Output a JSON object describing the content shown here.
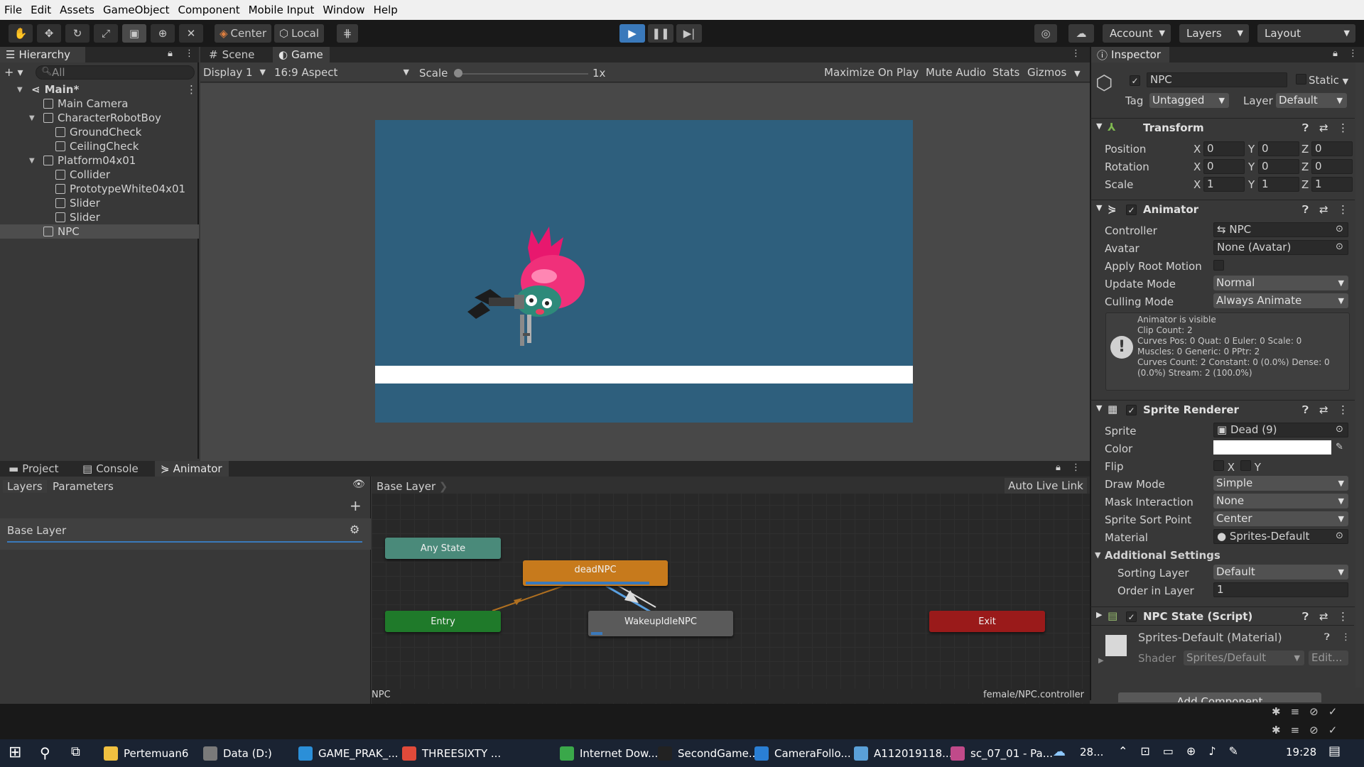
{
  "menu": [
    "File",
    "Edit",
    "Assets",
    "GameObject",
    "Component",
    "Mobile Input",
    "Window",
    "Help"
  ],
  "toolbar": {
    "pivot_label": "Center",
    "space_label": "Local",
    "account_label": "Account",
    "layers_label": "Layers",
    "layout_label": "Layout"
  },
  "hierarchy": {
    "tab_label": "Hierarchy",
    "search_placeholder": "All",
    "items": [
      {
        "label": "Main*",
        "depth": 0,
        "scene": true
      },
      {
        "label": "Main Camera",
        "depth": 1
      },
      {
        "label": "CharacterRobotBoy",
        "depth": 1,
        "expanded": true
      },
      {
        "label": "GroundCheck",
        "depth": 2
      },
      {
        "label": "CeilingCheck",
        "depth": 2
      },
      {
        "label": "Platform04x01",
        "depth": 1,
        "expanded": true
      },
      {
        "label": "Collider",
        "depth": 2
      },
      {
        "label": "PrototypeWhite04x01",
        "depth": 2
      },
      {
        "label": "Slider",
        "depth": 2
      },
      {
        "label": "Slider",
        "depth": 2
      },
      {
        "label": "NPC",
        "depth": 1,
        "selected": true
      }
    ]
  },
  "game_view": {
    "tabs": [
      "Scene",
      "Game"
    ],
    "display": "Display 1",
    "aspect": "16:9 Aspect",
    "scale_label": "Scale",
    "scale_value": "1x",
    "maximize": "Maximize On Play",
    "mute": "Mute Audio",
    "stats": "Stats",
    "gizmos": "Gizmos",
    "sky_color": "#2e5f7d"
  },
  "bottom": {
    "tabs": [
      "Project",
      "Console",
      "Animator"
    ],
    "layers_tab": "Layers",
    "params_tab": "Parameters",
    "base_layer": "Base Layer",
    "breadcrumb": "Base Layer",
    "auto_live_link": "Auto Live Link",
    "footer_left": "NPC",
    "footer_right": "female/NPC.controller",
    "nodes": {
      "any_state": "Any State",
      "dead": "deadNPC",
      "entry": "Entry",
      "wakeup": "WakeupIdleNPC",
      "exit": "Exit"
    }
  },
  "inspector": {
    "tab_label": "Inspector",
    "object_name": "NPC",
    "static_label": "Static",
    "tag_label": "Tag",
    "tag_value": "Untagged",
    "layer_label": "Layer",
    "layer_value": "Default",
    "transform": {
      "title": "Transform",
      "rows": [
        {
          "label": "Position",
          "x": "0",
          "y": "0",
          "z": "0"
        },
        {
          "label": "Rotation",
          "x": "0",
          "y": "0",
          "z": "0"
        },
        {
          "label": "Scale",
          "x": "1",
          "y": "1",
          "z": "1"
        }
      ]
    },
    "animator": {
      "title": "Animator",
      "controller_label": "Controller",
      "controller_value": "NPC",
      "avatar_label": "Avatar",
      "avatar_value": "None (Avatar)",
      "root_motion_label": "Apply Root Motion",
      "update_label": "Update Mode",
      "update_value": "Normal",
      "culling_label": "Culling Mode",
      "culling_value": "Always Animate",
      "info": [
        "Animator is visible",
        "Clip Count: 2",
        "Curves Pos: 0 Quat: 0 Euler: 0 Scale: 0",
        "Muscles: 0 Generic: 0 PPtr: 2",
        "Curves Count: 2 Constant: 0 (0.0%) Dense: 0",
        "(0.0%) Stream: 2 (100.0%)"
      ]
    },
    "sprite_renderer": {
      "title": "Sprite Renderer",
      "sprite_label": "Sprite",
      "sprite_value": "Dead (9)",
      "color_label": "Color",
      "flip_label": "Flip",
      "flip_x": "X",
      "flip_y": "Y",
      "draw_label": "Draw Mode",
      "draw_value": "Simple",
      "mask_label": "Mask Interaction",
      "mask_value": "None",
      "sort_point_label": "Sprite Sort Point",
      "sort_point_value": "Center",
      "material_label": "Material",
      "material_value": "Sprites-Default",
      "additional_label": "Additional Settings",
      "sorting_layer_label": "Sorting Layer",
      "sorting_layer_value": "Default",
      "order_label": "Order in Layer",
      "order_value": "1"
    },
    "npc_state": {
      "title": "NPC State (Script)"
    },
    "material": {
      "title": "Sprites-Default (Material)",
      "shader_label": "Shader",
      "shader_value": "Sprites/Default",
      "edit_label": "Edit..."
    },
    "add_component": "Add Component"
  },
  "taskbar": {
    "items": [
      {
        "label": "Pertemuan6",
        "color": "#f0c040"
      },
      {
        "label": "Data (D:)",
        "color": "#7a7a7a"
      },
      {
        "label": "GAME_PRAK_...",
        "color": "#2b8fd8"
      },
      {
        "label": "THREESIXTY ...",
        "color": "#e04a3a"
      },
      {
        "label": "Internet Dow...",
        "color": "#3aa84a"
      },
      {
        "label": "SecondGame...",
        "color": "#222222"
      },
      {
        "label": "CameraFollo...",
        "color": "#2a7fd4"
      },
      {
        "label": "A112019118...",
        "color": "#5aa0d8"
      },
      {
        "label": "sc_07_01 - Pa...",
        "color": "#c04a8a"
      }
    ],
    "temp": "28...",
    "time": "19:28"
  }
}
